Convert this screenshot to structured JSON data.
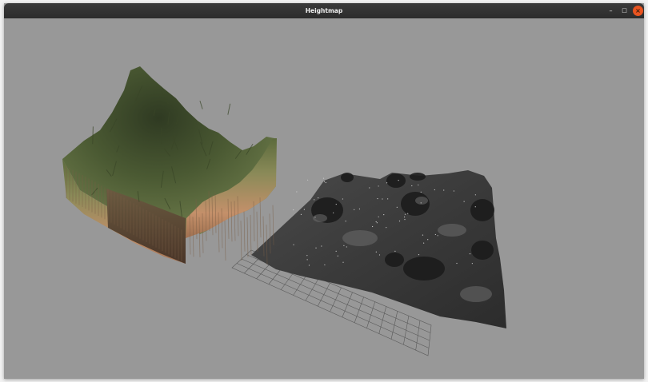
{
  "window": {
    "title": "Heightmap",
    "controls": {
      "minimize_glyph": "–",
      "maximize_glyph": "□",
      "close_glyph": "×",
      "close_color": "#e95420"
    }
  },
  "viewport": {
    "background": "#989898",
    "objects": [
      {
        "name": "mountain-terrain",
        "palette": [
          "#4b5a33",
          "#6f7d4c",
          "#c4906a",
          "#6a4a38"
        ]
      },
      {
        "name": "crater-terrain",
        "palette": [
          "#3e3e3e",
          "#6c6c6c",
          "#1f1f1f"
        ]
      },
      {
        "name": "ground-grid",
        "color": "#5a5a5a"
      }
    ]
  }
}
